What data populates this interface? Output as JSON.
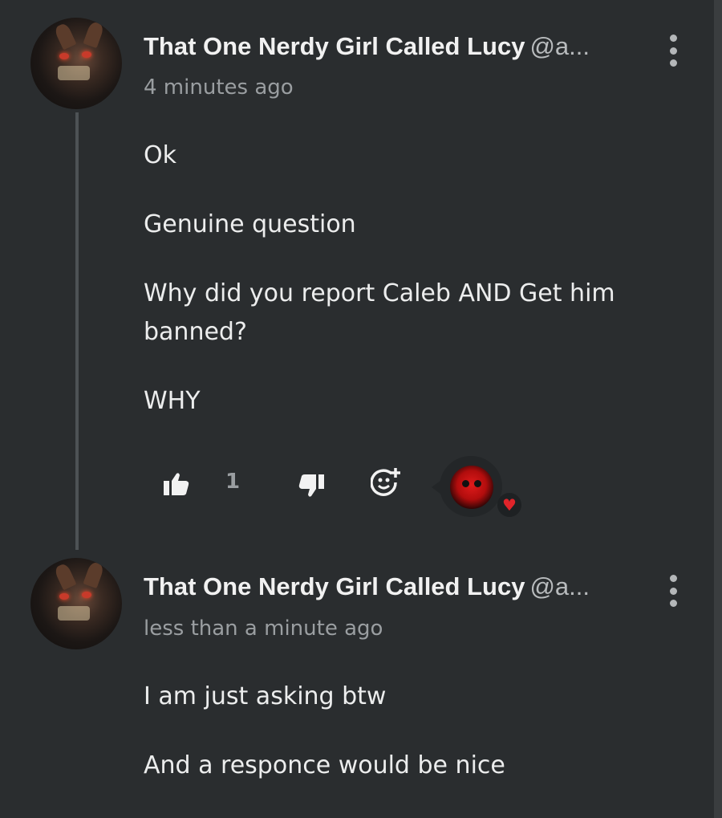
{
  "comments": [
    {
      "username": "That One Nerdy Girl Called Lucy",
      "handle": "@a...",
      "timestamp": "4 minutes ago",
      "paragraphs": [
        "Ok",
        "Genuine question",
        "Why did you report Caleb AND Get him banned?",
        "WHY"
      ],
      "likes": "1",
      "reaction_icon": "heart-icon"
    },
    {
      "username": "That One Nerdy Girl Called Lucy",
      "handle": "@a...",
      "timestamp": "less than a minute ago",
      "paragraphs": [
        "I am just asking btw",
        "And a responce would be nice"
      ]
    }
  ],
  "colors": {
    "background": "#2a2d2f",
    "text": "#eceded",
    "muted": "#9a9ea1",
    "heart": "#e0242a"
  }
}
